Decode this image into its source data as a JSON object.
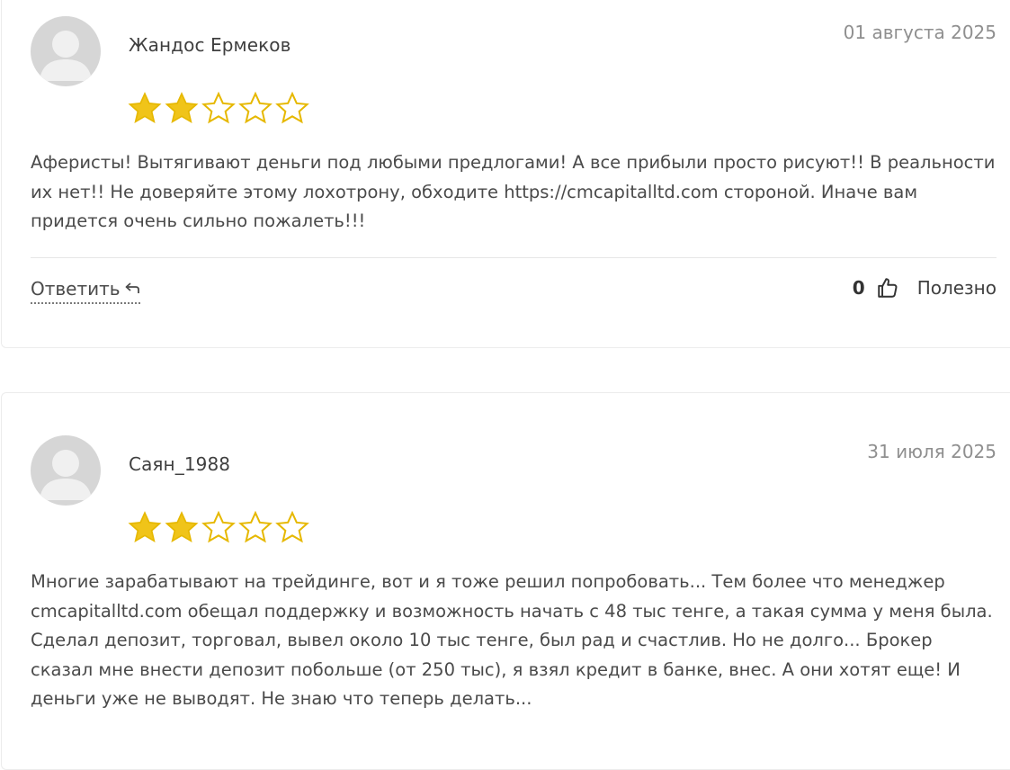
{
  "colors": {
    "star_filled": "#F0C419",
    "star_empty_stroke": "#E6B800",
    "avatar_bg": "#d6d6d6",
    "avatar_fg": "#f2f2f2",
    "date": "#8f8f8f"
  },
  "reviews": [
    {
      "author": "Жандос Ермеков",
      "date": "01 августа 2025",
      "rating": 2,
      "rating_max": 5,
      "text": "Аферисты! Вытягивают деньги под любыми предлогами! А все прибыли просто рисуют!! В реальности их нет!! Не доверяйте этому лохотрону, обходите https://cmcapitalltd.com стороной. Иначе вам придется очень сильно пожалеть!!!",
      "reply_label": "Ответить",
      "helpful_count": "0",
      "helpful_label": "Полезно"
    },
    {
      "author": "Саян_1988",
      "date": "31 июля 2025",
      "rating": 2,
      "rating_max": 5,
      "text": "Многие зарабатывают на трейдинге, вот и я тоже решил попробовать... Тем более что менеджер cmcapitalltd.com обещал поддержку и возможность начать с 48 тыс тенге, а такая сумма у меня была. Сделал депозит, торговал, вывел около 10 тыс тенге, был рад и счастлив. Но не долго... Брокер сказал мне внести депозит побольше (от 250 тыс), я взял кредит в банке, внес. А они хотят еще! И деньги уже не выводят. Не знаю что теперь делать..."
    }
  ]
}
